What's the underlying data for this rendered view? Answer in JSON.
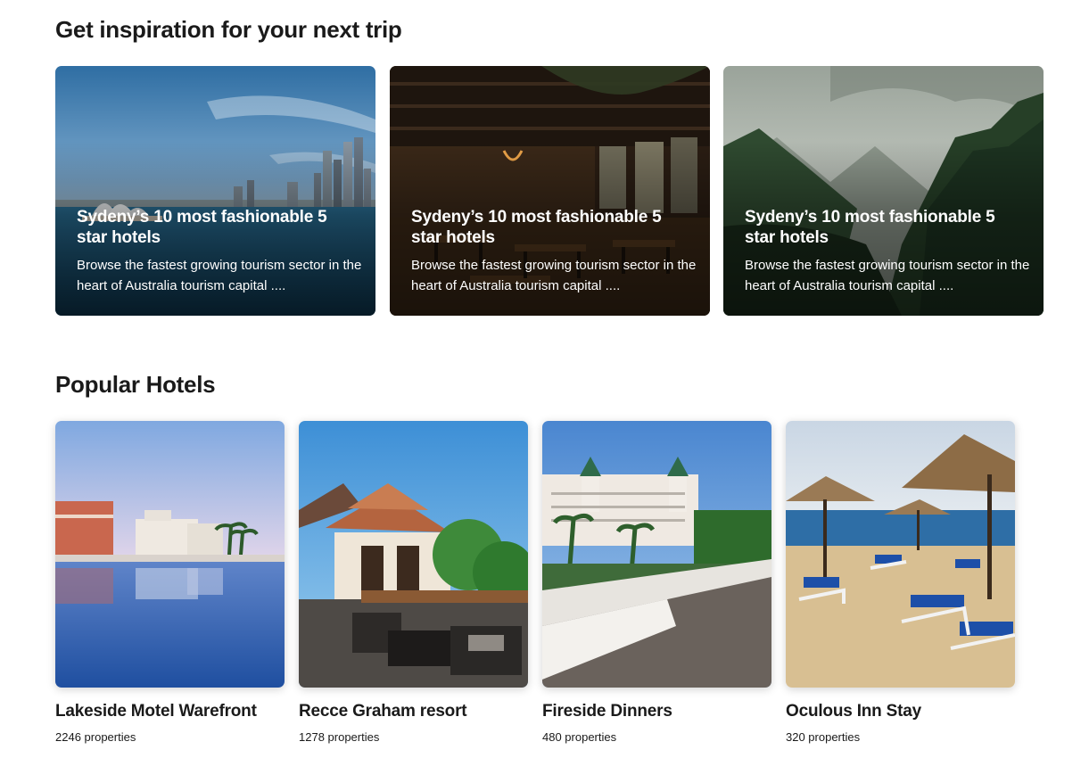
{
  "sections": {
    "inspiration_title": "Get inspiration for your next trip",
    "popular_title": "Popular Hotels"
  },
  "inspiration": [
    {
      "title": "Sydeny’s 10 most fashionable 5 star hotels",
      "description": "Browse the fastest growing tourism sector in the heart of Australia tourism capital ...."
    },
    {
      "title": "Sydeny’s 10 most fashionable 5 star hotels",
      "description": "Browse the fastest growing tourism sector in the heart of Australia tourism capital ...."
    },
    {
      "title": "Sydeny’s 10 most fashionable 5 star hotels",
      "description": "Browse the fastest growing tourism sector in the heart of Australia tourism capital ...."
    }
  ],
  "hotels": [
    {
      "name": "Lakeside Motel Warefront",
      "count": "2246 properties"
    },
    {
      "name": "Recce Graham resort",
      "count": "1278 properties"
    },
    {
      "name": "Fireside Dinners",
      "count": "480 properties"
    },
    {
      "name": "Oculous Inn Stay",
      "count": "320 properties"
    }
  ]
}
